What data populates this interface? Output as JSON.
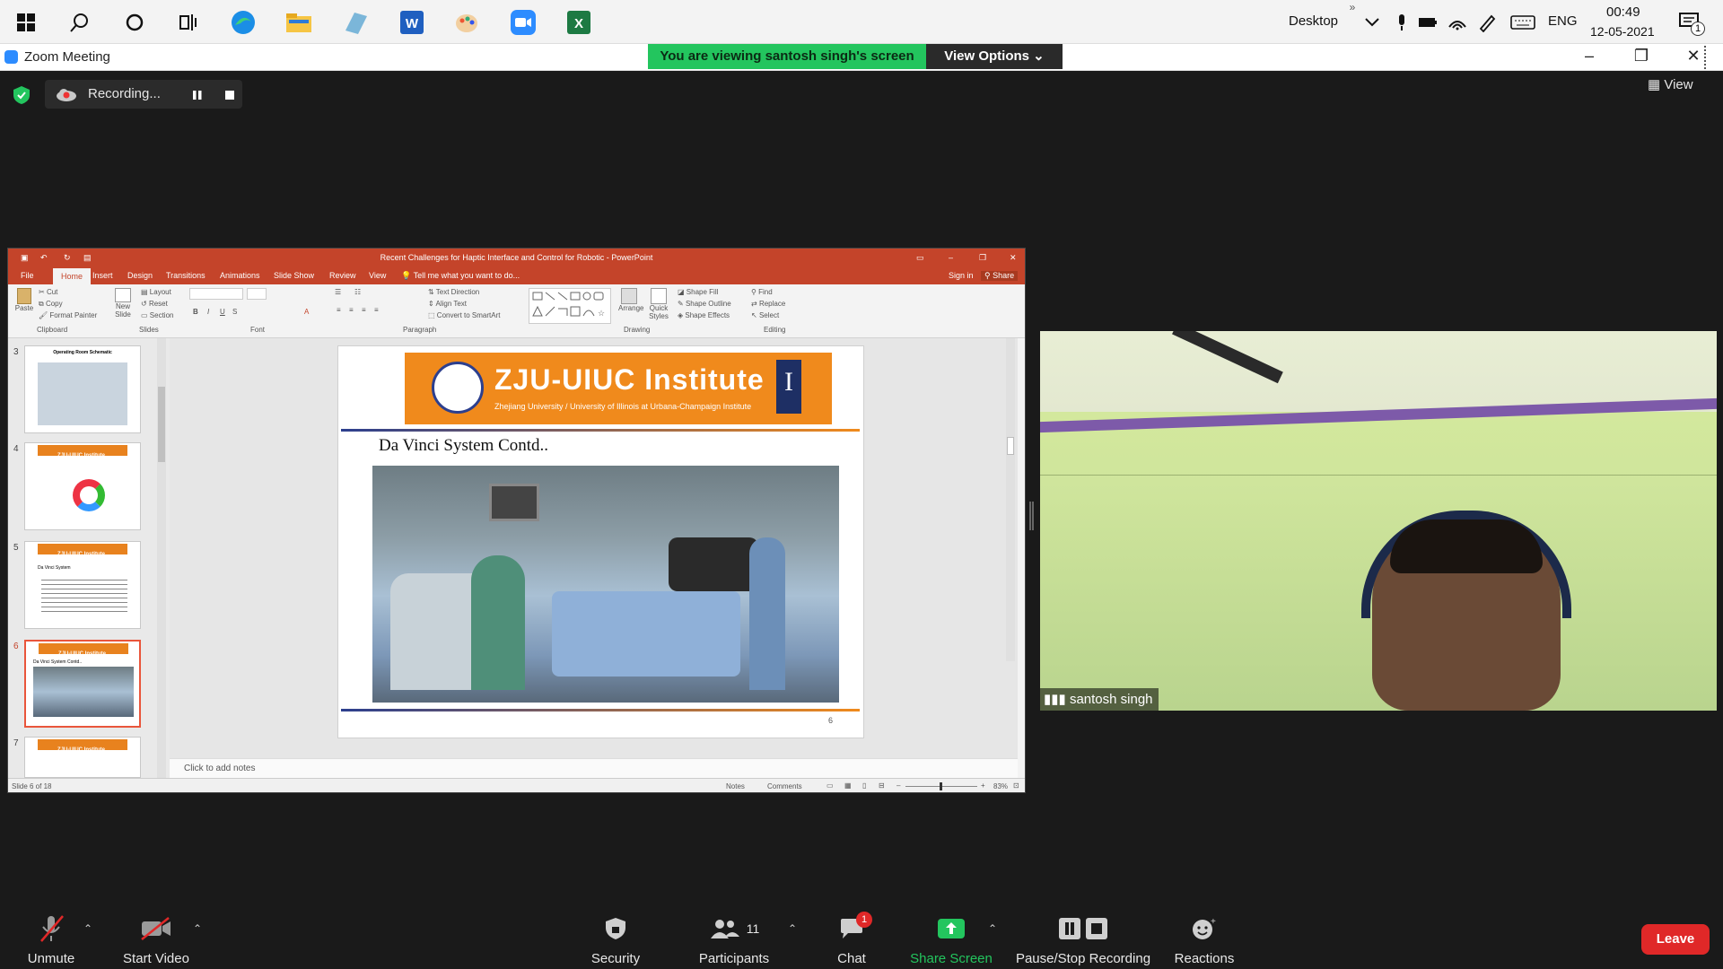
{
  "taskbar": {
    "desktop_label": "Desktop",
    "language": "ENG",
    "time": "00:49",
    "date": "12-05-2021",
    "notification_count": "1"
  },
  "window": {
    "title": "Zoom Meeting",
    "sharing_banner": "You are viewing santosh singh's screen",
    "view_options": "View Options"
  },
  "meeting": {
    "recording_label": "Recording...",
    "view_label": "View"
  },
  "ppt": {
    "title": "Recent Challenges for Haptic Interface and Control for Robotic - PowerPoint",
    "tabs": [
      "File",
      "Home",
      "Insert",
      "Design",
      "Transitions",
      "Animations",
      "Slide Show",
      "Review",
      "View"
    ],
    "tell_me": "Tell me what you want to do...",
    "sign_in": "Sign in",
    "share": "Share",
    "ribbon_groups": [
      "Clipboard",
      "Slides",
      "Font",
      "Paragraph",
      "Drawing",
      "Editing"
    ],
    "clipboard_items": [
      "Paste",
      "Cut",
      "Copy",
      "Format Painter"
    ],
    "slides_items": [
      "New Slide",
      "Layout",
      "Reset",
      "Section"
    ],
    "paragraph_items": [
      "Text Direction",
      "Align Text",
      "Convert to SmartArt"
    ],
    "drawing_items": [
      "Arrange",
      "Quick Styles",
      "Shape Fill",
      "Shape Outline",
      "Shape Effects"
    ],
    "editing_items": [
      "Find",
      "Replace",
      "Select"
    ],
    "thumbnails": [
      {
        "num": "3",
        "title": "Operating Room Schematic"
      },
      {
        "num": "4",
        "title": "ZJU-UIUC Institute"
      },
      {
        "num": "5",
        "title": "Da Vinci System"
      },
      {
        "num": "6",
        "title": "Da Vinci System Contd.."
      },
      {
        "num": "7",
        "title": "ZJU-UIUC Institute"
      }
    ],
    "slide": {
      "banner_title": "ZJU-UIUC Institute",
      "banner_subtitle": "Zhejiang University / University of Illinois at Urbana-Champaign Institute",
      "heading": "Da Vinci System Contd..",
      "page_number": "6"
    },
    "notes_placeholder": "Click to add notes",
    "status_slide": "Slide 6 of 18",
    "status_notes": "Notes",
    "status_comments": "Comments",
    "zoom": "83%"
  },
  "participant": {
    "name": "santosh singh"
  },
  "toolbar": {
    "unmute": "Unmute",
    "start_video": "Start Video",
    "security": "Security",
    "participants": "Participants",
    "participants_count": "11",
    "chat": "Chat",
    "chat_badge": "1",
    "share_screen": "Share Screen",
    "pause_stop": "Pause/Stop Recording",
    "reactions": "Reactions",
    "leave": "Leave"
  },
  "colors": {
    "banner_green": "#23c55e",
    "share_green": "#23c55e",
    "ppt_red": "#c4442a",
    "leave_red": "#e02828",
    "slide_orange": "#f08a1c"
  }
}
